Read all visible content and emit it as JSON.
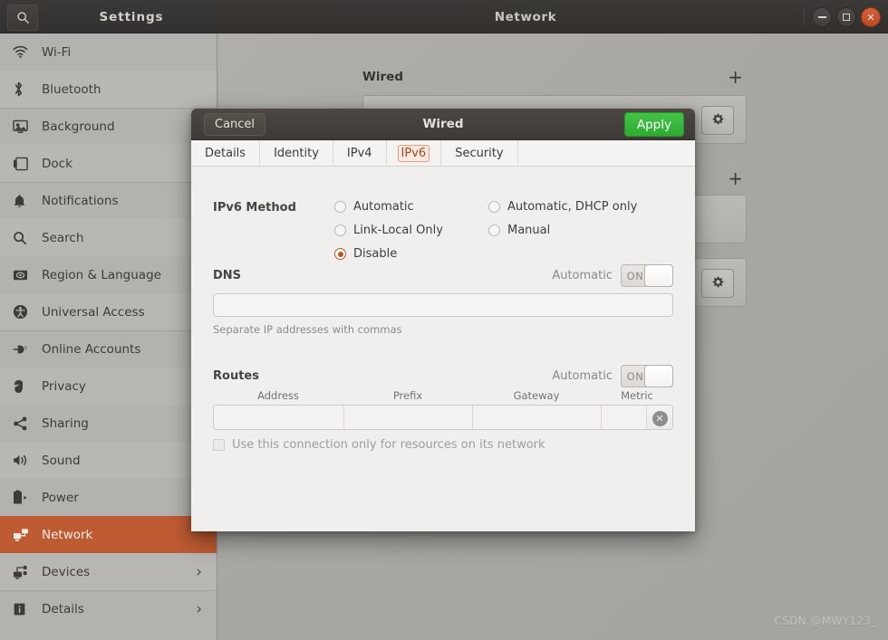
{
  "window": {
    "settings_title": "Settings",
    "main_title": "Network",
    "search_icon": "search-icon",
    "controls": {
      "minimize": "−",
      "maximize": "□",
      "close": "×"
    }
  },
  "sidebar": {
    "items": [
      {
        "label": "Wi-Fi",
        "icon": "wifi-icon",
        "chevron": ""
      },
      {
        "label": "Bluetooth",
        "icon": "bluetooth-icon",
        "chevron": ""
      },
      {
        "label": "Background",
        "icon": "background-icon",
        "chevron": ""
      },
      {
        "label": "Dock",
        "icon": "dock-icon",
        "chevron": ""
      },
      {
        "label": "Notifications",
        "icon": "bell-icon",
        "chevron": ""
      },
      {
        "label": "Search",
        "icon": "search-icon",
        "chevron": ""
      },
      {
        "label": "Region & Language",
        "icon": "region-language-icon",
        "chevron": ""
      },
      {
        "label": "Universal Access",
        "icon": "universal-access-icon",
        "chevron": ""
      },
      {
        "label": "Online Accounts",
        "icon": "online-accounts-icon",
        "chevron": ""
      },
      {
        "label": "Privacy",
        "icon": "privacy-hand-icon",
        "chevron": ""
      },
      {
        "label": "Sharing",
        "icon": "sharing-icon",
        "chevron": ""
      },
      {
        "label": "Sound",
        "icon": "sound-icon",
        "chevron": ""
      },
      {
        "label": "Power",
        "icon": "power-battery-icon",
        "chevron": ""
      },
      {
        "label": "Network",
        "icon": "network-icon",
        "chevron": "",
        "active": true
      },
      {
        "label": "Devices",
        "icon": "devices-icon",
        "chevron": "›"
      },
      {
        "label": "Details",
        "icon": "details-info-icon",
        "chevron": "›"
      }
    ],
    "active_color": "#bf5b33"
  },
  "background_page": {
    "wired_heading": "Wired",
    "add_button": "+",
    "gear_icon": "gear-icon"
  },
  "dialog": {
    "title": "Wired",
    "cancel_label": "Cancel",
    "apply_label": "Apply",
    "apply_color": "#33b233",
    "accent_color": "#c0522a",
    "tabs": [
      {
        "label": "Details",
        "selected": false
      },
      {
        "label": "Identity",
        "selected": false
      },
      {
        "label": "IPv4",
        "selected": false
      },
      {
        "label": "IPv6",
        "selected": true
      },
      {
        "label": "Security",
        "selected": false
      }
    ],
    "method": {
      "section_label": "IPv6 Method",
      "options": [
        {
          "label": "Automatic",
          "selected": false
        },
        {
          "label": "Automatic, DHCP only",
          "selected": false
        },
        {
          "label": "Link-Local Only",
          "selected": false
        },
        {
          "label": "Manual",
          "selected": false
        },
        {
          "label": "Disable",
          "selected": true
        }
      ]
    },
    "dns": {
      "section_label": "DNS",
      "automatic_label": "Automatic",
      "toggle_state": "ON",
      "value": "",
      "hint": "Separate IP addresses with commas"
    },
    "routes": {
      "section_label": "Routes",
      "automatic_label": "Automatic",
      "toggle_state": "ON",
      "columns": [
        "Address",
        "Prefix",
        "Gateway",
        "Metric"
      ],
      "rows": [
        {
          "address": "",
          "prefix": "",
          "gateway": "",
          "metric": ""
        }
      ],
      "delete_icon": "delete-circle-icon",
      "checkbox_label": "Use this connection only for resources on its network",
      "checkbox_checked": false
    }
  },
  "watermark": "CSDN @MWY123_"
}
